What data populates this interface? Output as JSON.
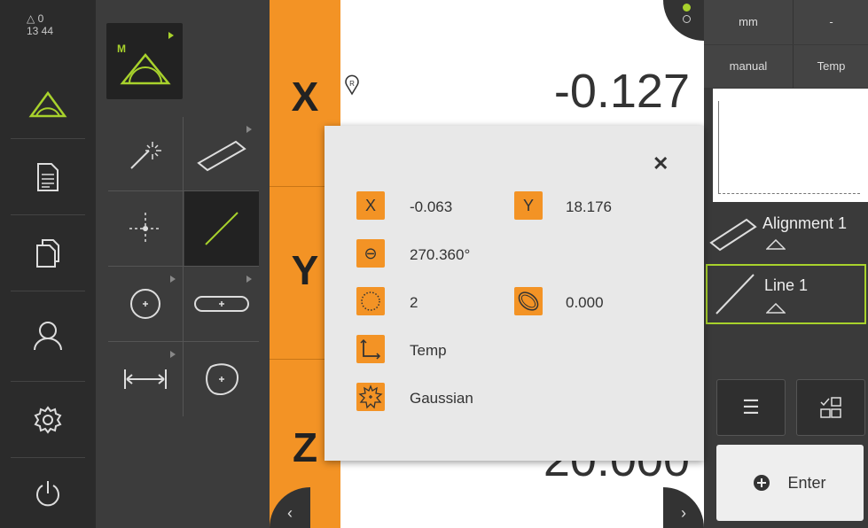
{
  "status": {
    "warning_count": "0",
    "time": "13 44"
  },
  "axes": {
    "x": {
      "label": "X",
      "value": "-0.127"
    },
    "y": {
      "label": "Y"
    },
    "z": {
      "label": "Z",
      "value": "20.000"
    }
  },
  "right_panel": {
    "unit": "mm",
    "unit_right": "-",
    "mode": "manual",
    "coord_system": "Temp",
    "features": [
      {
        "name": "Alignment 1"
      },
      {
        "name": "Line 1"
      }
    ],
    "enter_label": "Enter"
  },
  "popup": {
    "x_label": "X",
    "x_value": "-0.063",
    "y_label": "Y",
    "y_value": "18.176",
    "angle_value": "270.360°",
    "point_count": "2",
    "form_error": "0.000",
    "reference_system": "Temp",
    "filter": "Gaussian",
    "close_symbol": "✕"
  },
  "palette": {
    "measure_mode_label": "M"
  },
  "colors": {
    "accent": "#f39325",
    "measure_green": "#a8d22c",
    "background": "#333333"
  },
  "icons": [
    "warning-triangle-icon",
    "measure-icon",
    "protocol-icon",
    "files-icon",
    "user-icon",
    "settings-icon",
    "power-icon",
    "auto-detect-icon",
    "line-slot-icon",
    "point-icon",
    "line-icon",
    "circle-icon",
    "slot-icon",
    "distance-icon",
    "blob-icon",
    "reference-icon",
    "list-icon",
    "grid-view-icon",
    "plus-circle-icon",
    "chevron-left-icon",
    "chevron-right-icon",
    "angle-icon",
    "points-count-icon",
    "form-error-icon",
    "coord-system-icon",
    "filter-icon"
  ]
}
